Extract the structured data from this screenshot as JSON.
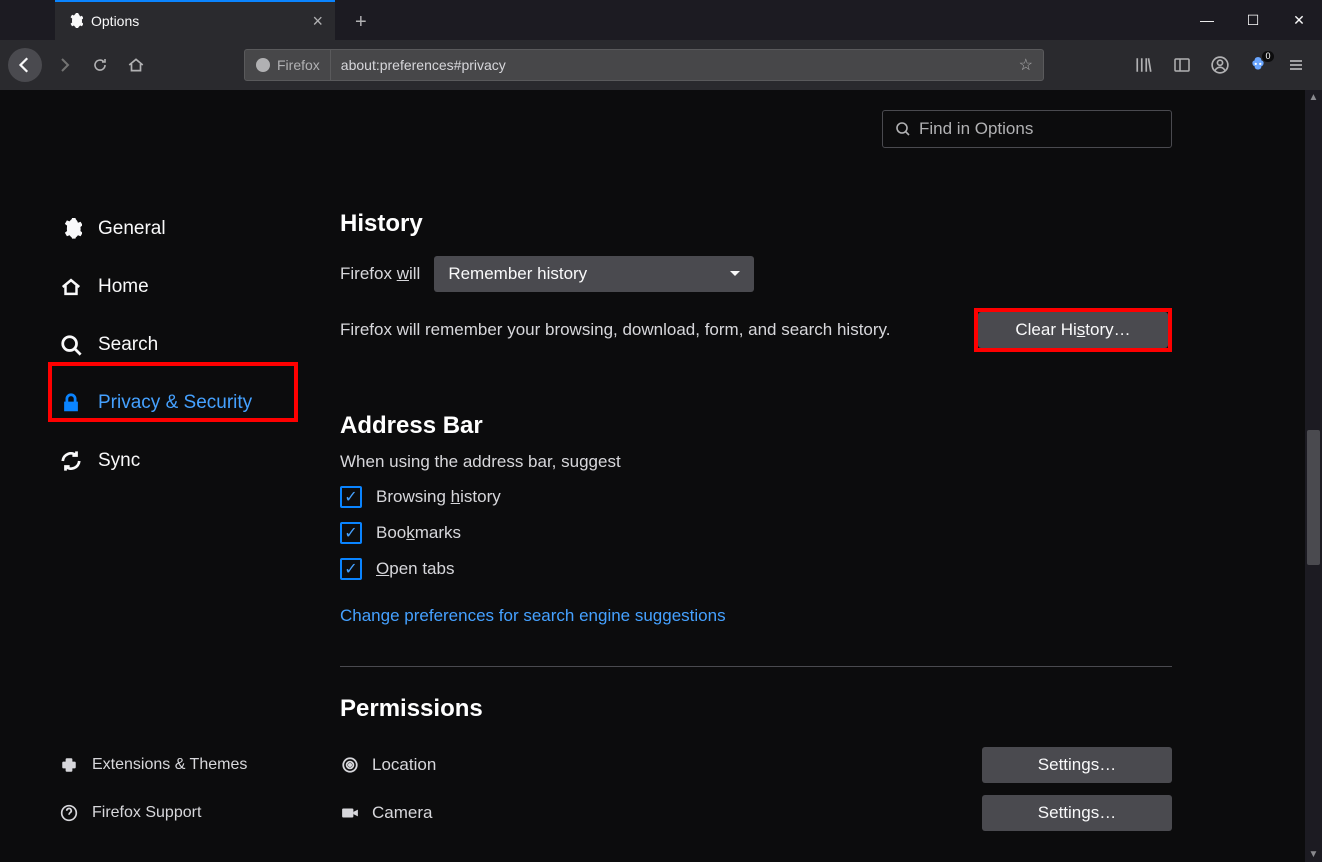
{
  "tab": {
    "title": "Options"
  },
  "addressbar": {
    "identity": "Firefox",
    "url": "about:preferences#privacy"
  },
  "search": {
    "placeholder": "Find in Options"
  },
  "sidebar": {
    "items": [
      {
        "label": "General"
      },
      {
        "label": "Home"
      },
      {
        "label": "Search"
      },
      {
        "label": "Privacy & Security"
      },
      {
        "label": "Sync"
      }
    ],
    "bottom": [
      {
        "label": "Extensions & Themes"
      },
      {
        "label": "Firefox Support"
      }
    ]
  },
  "history": {
    "heading": "History",
    "will_label_prefix": "Firefox ",
    "will_label_u": "w",
    "will_label_suffix": "ill",
    "dropdown": "Remember history",
    "desc": "Firefox will remember your browsing, download, form, and search history.",
    "clear_btn_prefix": "Clear Hi",
    "clear_btn_u": "s",
    "clear_btn_suffix": "tory…"
  },
  "addressbar_section": {
    "heading": "Address Bar",
    "sub": "When using the address bar, suggest",
    "chk1_prefix": "Browsing ",
    "chk1_u": "h",
    "chk1_suffix": "istory",
    "chk2_prefix": "Boo",
    "chk2_u": "k",
    "chk2_suffix": "marks",
    "chk3_u": "O",
    "chk3_suffix": "pen tabs",
    "link": "Change preferences for search engine suggestions"
  },
  "permissions": {
    "heading": "Permissions",
    "location": "Location",
    "camera": "Camera",
    "settings_btn": "Settings…"
  },
  "extension_badge": "0"
}
